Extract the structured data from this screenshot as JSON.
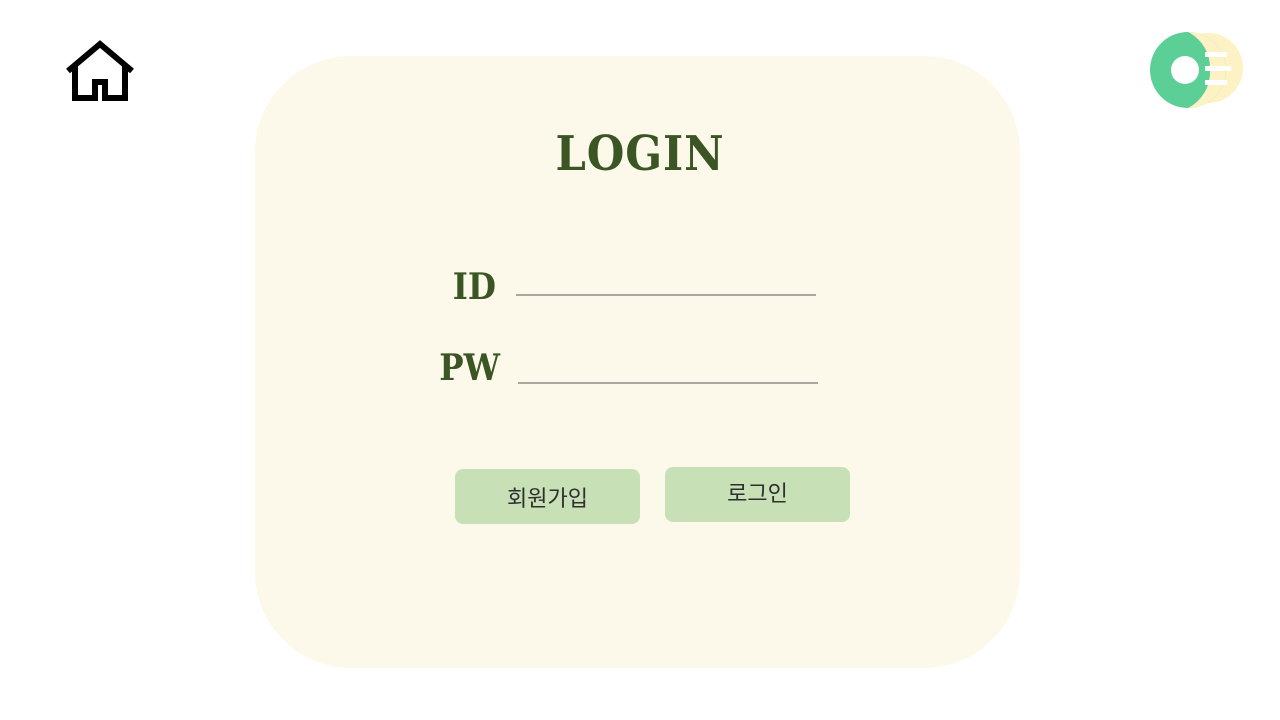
{
  "header": {
    "home_icon": "home-icon",
    "logo_icon": "brand-logo-icon"
  },
  "login": {
    "title": "LOGIN",
    "id_label": "ID",
    "pw_label": "PW",
    "id_value": "",
    "pw_value": "",
    "signup_label": "회원가입",
    "login_label": "로그인"
  },
  "colors": {
    "card_background": "#fcf9ea",
    "title_green": "#3b5524",
    "button_green": "#c7e0b6",
    "logo_teal": "#5ccf96",
    "logo_cream": "#fdf2c4"
  }
}
